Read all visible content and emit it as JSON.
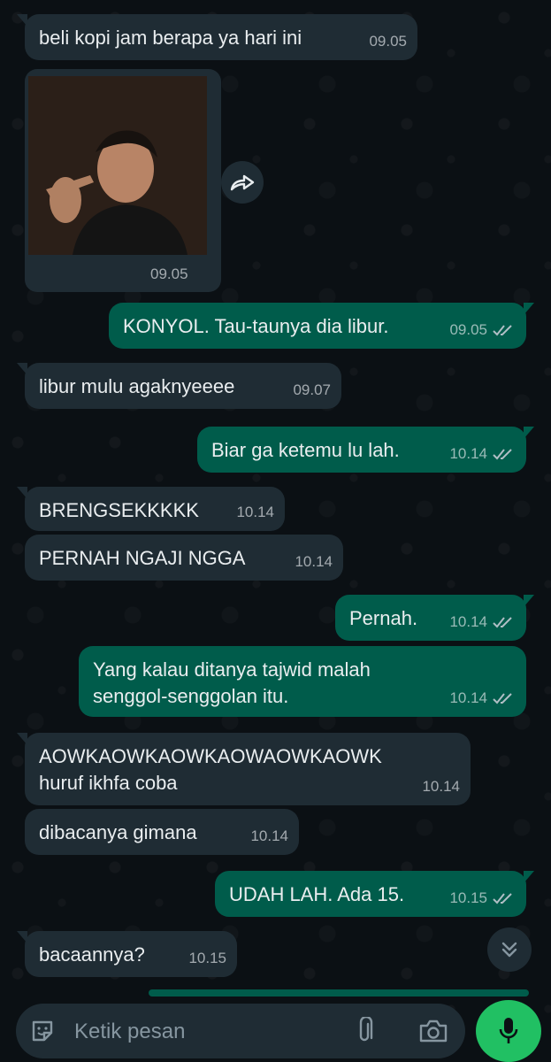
{
  "messages": [
    {
      "dir": "in",
      "text": "beli kopi jam berapa ya hari ini",
      "time": "09.05"
    },
    {
      "dir": "in",
      "type": "video",
      "time": "09.05"
    },
    {
      "dir": "out",
      "text": "KONYOL. Tau-taunya dia libur.",
      "time": "09.05",
      "ticks": "read"
    },
    {
      "dir": "in",
      "text": "libur mulu agaknyeeee",
      "time": "09.07"
    },
    {
      "dir": "out",
      "text": "Biar ga ketemu lu lah.",
      "time": "10.14",
      "ticks": "read"
    },
    {
      "dir": "in",
      "text": "BRENGSEKKKKK",
      "time": "10.14"
    },
    {
      "dir": "in",
      "text": "PERNAH NGAJI NGGA",
      "time": "10.14"
    },
    {
      "dir": "out",
      "text": "Pernah.",
      "time": "10.14",
      "ticks": "read"
    },
    {
      "dir": "out",
      "text": "Yang kalau ditanya tajwid malah\nsenggol-senggolan itu.",
      "time": "10.14",
      "ticks": "read"
    },
    {
      "dir": "in",
      "text": "AOWKAOWKAOWKAOWAOWKAOWK\nhuruf ikhfa coba",
      "time": "10.14"
    },
    {
      "dir": "in",
      "text": "dibacanya gimana",
      "time": "10.14"
    },
    {
      "dir": "out",
      "text": "UDAH LAH. Ada 15.",
      "time": "10.15",
      "ticks": "read"
    },
    {
      "dir": "in",
      "text": "bacaannya?",
      "time": "10.15"
    }
  ],
  "composer": {
    "placeholder": "Ketik pesan",
    "icons": [
      "sticker-icon",
      "attach-icon",
      "camera-icon",
      "mic-icon"
    ]
  },
  "colors": {
    "incoming_bubble": "#1f2c34",
    "outgoing_bubble": "#005c4b",
    "accent": "#21c063",
    "read_ticks": "#8696a0"
  }
}
